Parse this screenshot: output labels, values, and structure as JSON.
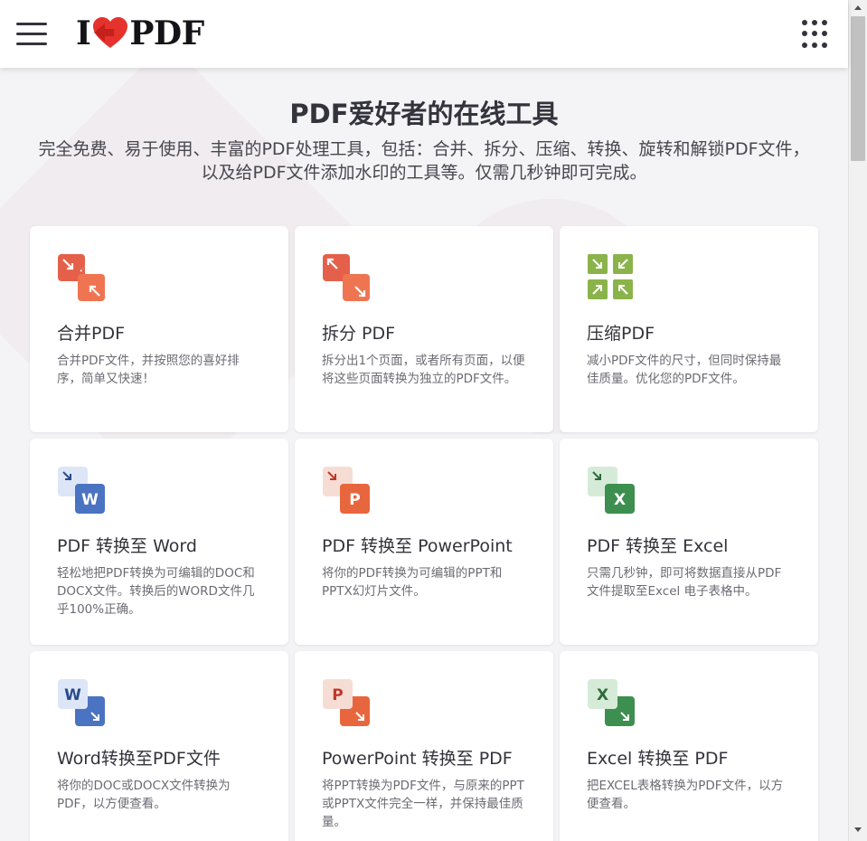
{
  "header": {
    "logo_prefix": "I",
    "logo_suffix": "PDF",
    "brand_color": "#e5322d",
    "menu_icon": "hamburger-icon",
    "apps_icon": "grid-apps-icon"
  },
  "hero": {
    "title": "PDF爱好者的在线工具",
    "subtitle": "完全免费、易于使用、丰富的PDF处理工具，包括：合并、拆分、压缩、转换、旋转和解锁PDF文件，以及给PDF文件添加水印的工具等。仅需几秒钟即可完成。"
  },
  "tools": [
    {
      "title": "合并PDF",
      "desc": "合并PDF文件，并按照您的喜好排序，简单又快速！",
      "icon": "merge-pdf-icon"
    },
    {
      "title": "拆分 PDF",
      "desc": "拆分出1个页面，或者所有页面，以便将这些页面转换为独立的PDF文件。",
      "icon": "split-pdf-icon"
    },
    {
      "title": "压缩PDF",
      "desc": "减小PDF文件的尺寸，但同时保持最佳质量。优化您的PDF文件。",
      "icon": "compress-pdf-icon"
    },
    {
      "title": "PDF 转换至 Word",
      "desc": "轻松地把PDF转换为可编辑的DOC和DOCX文件。转换后的WORD文件几乎100%正确。",
      "icon": "pdf-to-word-icon"
    },
    {
      "title": "PDF 转换至 PowerPoint",
      "desc": "将你的PDF转换为可编辑的PPT和PPTX幻灯片文件。",
      "icon": "pdf-to-powerpoint-icon"
    },
    {
      "title": "PDF 转换至 Excel",
      "desc": "只需几秒钟，即可将数据直接从PDF文件提取至Excel 电子表格中。",
      "icon": "pdf-to-excel-icon"
    },
    {
      "title": "Word转换至PDF文件",
      "desc": "将你的DOC或DOCX文件转换为PDF，以方便查看。",
      "icon": "word-to-pdf-icon"
    },
    {
      "title": "PowerPoint 转换至 PDF",
      "desc": "将PPT转换为PDF文件，与原来的PPT或PPTX文件完全一样，并保持最佳质量。",
      "icon": "powerpoint-to-pdf-icon"
    },
    {
      "title": "Excel 转换至 PDF",
      "desc": "把EXCEL表格转换为PDF文件，以方便查看。",
      "icon": "excel-to-pdf-icon"
    }
  ],
  "icon_letters": {
    "word": "W",
    "powerpoint": "P",
    "excel": "X"
  },
  "colors": {
    "merge": "#e5604a",
    "compress": "#8bb34b",
    "word": "#4a73c1",
    "word_light": "#dde6f7",
    "powerpoint": "#e8663d",
    "powerpoint_light": "#f6ddd4",
    "excel": "#3d8f4f",
    "excel_light": "#d5ebd8"
  }
}
